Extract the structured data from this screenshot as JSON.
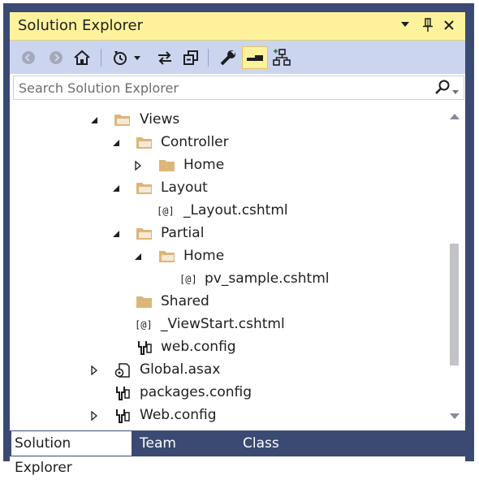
{
  "window": {
    "title": "Solution Explorer"
  },
  "toolbar": {
    "buttons": [
      {
        "icon": "back-icon",
        "enabled": false
      },
      {
        "icon": "forward-icon",
        "enabled": false
      },
      {
        "icon": "home-icon",
        "enabled": true
      },
      {
        "icon": "pending-changes-filter-icon",
        "enabled": true
      },
      {
        "icon": "sync-with-active-document-icon",
        "enabled": true
      },
      {
        "icon": "collapse-all-icon",
        "enabled": true
      },
      {
        "icon": "properties-icon",
        "enabled": true
      },
      {
        "icon": "preview-selected-items-icon",
        "enabled": true,
        "active": true
      },
      {
        "icon": "class-diagram-icon",
        "enabled": true
      }
    ]
  },
  "search": {
    "placeholder": "Search Solution Explorer"
  },
  "tree": {
    "items": [
      {
        "label": "Views",
        "icon": "folder-open-icon",
        "expander": "expanded"
      },
      {
        "label": "Controller",
        "icon": "folder-open-icon",
        "expander": "expanded"
      },
      {
        "label": "Home",
        "icon": "folder-closed-icon",
        "expander": "collapsed"
      },
      {
        "label": "Layout",
        "icon": "folder-open-icon",
        "expander": "expanded"
      },
      {
        "label": "_Layout.cshtml",
        "icon": "razor-file-icon",
        "expander": "none"
      },
      {
        "label": "Partial",
        "icon": "folder-open-icon",
        "expander": "expanded"
      },
      {
        "label": "Home",
        "icon": "folder-open-icon",
        "expander": "expanded"
      },
      {
        "label": "pv_sample.cshtml",
        "icon": "razor-file-icon",
        "expander": "none"
      },
      {
        "label": "Shared",
        "icon": "folder-closed-icon",
        "expander": "none"
      },
      {
        "label": "_ViewStart.cshtml",
        "icon": "razor-file-icon",
        "expander": "none"
      },
      {
        "label": "web.config",
        "icon": "config-file-icon",
        "expander": "none"
      },
      {
        "label": "Global.asax",
        "icon": "global-asax-icon",
        "expander": "collapsed"
      },
      {
        "label": "packages.config",
        "icon": "config-file-icon",
        "expander": "none"
      },
      {
        "label": "Web.config",
        "icon": "config-file-icon",
        "expander": "collapsed"
      }
    ]
  },
  "tabs": [
    {
      "label": "Solution Explorer",
      "active": true
    },
    {
      "label": "Team Explorer",
      "active": false
    },
    {
      "label": "Class View",
      "active": false
    }
  ],
  "colors": {
    "frame": "#3a4a73",
    "title_bar": "#fff29d",
    "toolbar": "#ccd5f0",
    "folder": "#dcb67a"
  }
}
